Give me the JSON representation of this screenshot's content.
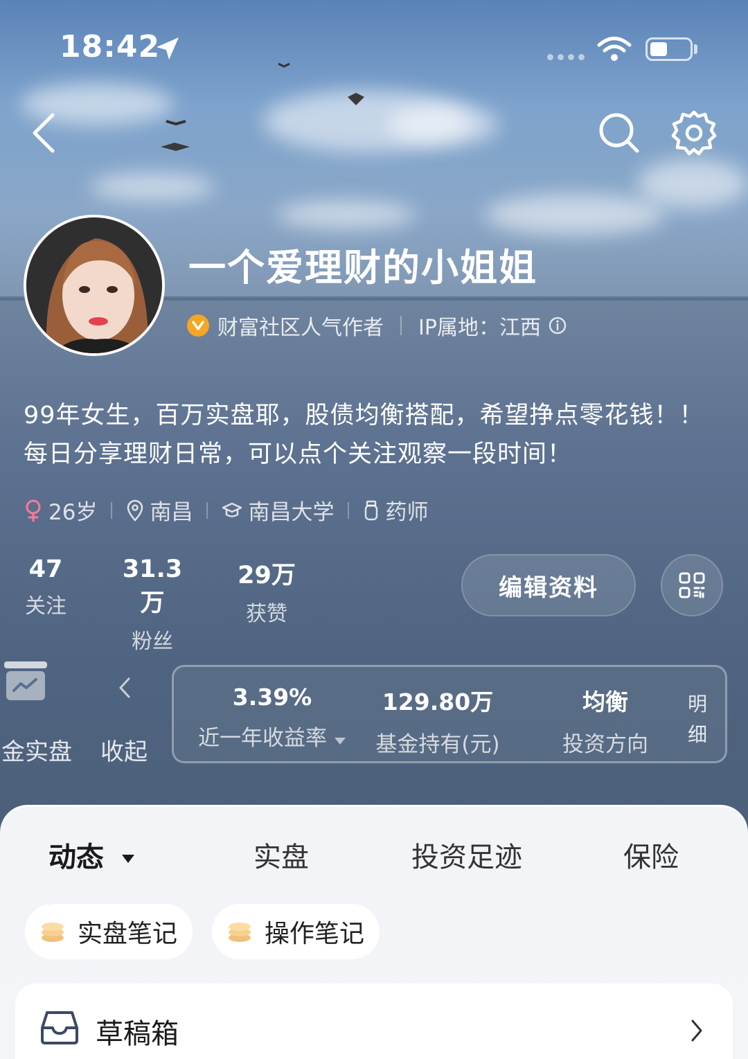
{
  "status_bar": {
    "time": "18:42"
  },
  "profile": {
    "nickname": "一个爱理财的小姐姐",
    "badge_label": "财富社区人气作者",
    "ip_location": "IP属地：江西",
    "bio": "99年女生，百万实盘耶，股债均衡搭配，希望挣点零花钱！！每日分享理财日常，可以点个关注观察一段时间！",
    "tags": [
      {
        "icon": "female-icon",
        "label": "26岁"
      },
      {
        "icon": "location-pin-icon",
        "label": "南昌"
      },
      {
        "icon": "graduation-cap-icon",
        "label": "南昌大学"
      },
      {
        "icon": "occupation-icon",
        "label": "药师"
      }
    ]
  },
  "stats": [
    {
      "value": "47",
      "label": "关注"
    },
    {
      "value": "31.3万",
      "label": "粉丝"
    },
    {
      "value": "29万",
      "label": "获赞"
    }
  ],
  "buttons": {
    "edit_profile": "编辑资料"
  },
  "portfolio": {
    "gold_label": "金实盘",
    "collapse_label": "收起",
    "items": [
      {
        "value": "3.39%",
        "label": "近一年收益率"
      },
      {
        "value": "129.80万",
        "label": "基金持有(元)"
      },
      {
        "value": "均衡",
        "label": "投资方向"
      }
    ],
    "detail_label_1": "明",
    "detail_label_2": "细"
  },
  "tabs": [
    {
      "label": "动态",
      "active": true
    },
    {
      "label": "实盘"
    },
    {
      "label": "投资足迹"
    },
    {
      "label": "保险"
    }
  ],
  "chips": [
    {
      "label": "实盘笔记"
    },
    {
      "label": "操作笔记"
    }
  ],
  "drafts": {
    "label": "草稿箱"
  },
  "colors": {
    "accent_blue": "#2b6fe6",
    "badge_orange": "#f5a623",
    "sheet_bg": "#f2f4f8",
    "female_pink": "#ff7a9a"
  }
}
